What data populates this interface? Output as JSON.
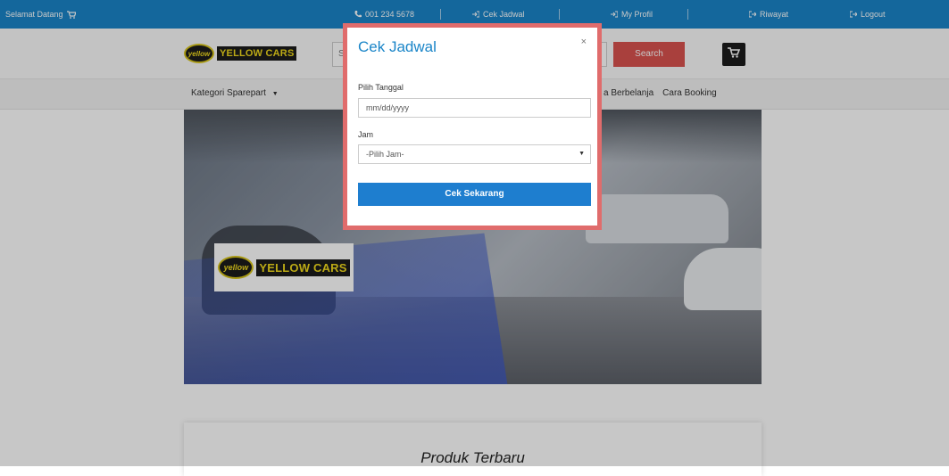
{
  "topbar": {
    "welcome": "Selamat Datang",
    "phone": "001 234 5678",
    "links": [
      "Cek Jadwal",
      "My Profil",
      "Riwayat",
      "Logout"
    ]
  },
  "header": {
    "logo_badge": "yellow",
    "logo_text": "YELLOW CARS",
    "search_placeholder": "S",
    "search_button": "Search"
  },
  "nav": {
    "kategori": "Kategori Sparepart",
    "links": [
      "a Berbelanja",
      "Cara Booking"
    ]
  },
  "banner": {
    "logo_badge": "yellow",
    "logo_text": "YELLOW CARS"
  },
  "produk": {
    "title": "Produk Terbaru"
  },
  "modal": {
    "title": "Cek Jadwal",
    "close": "×",
    "date_label": "Pilih Tanggal",
    "date_placeholder": "mm/dd/yyyy",
    "time_label": "Jam",
    "time_selected": "-Pilih Jam-",
    "submit": "Cek Sekarang"
  },
  "colors": {
    "topbar": "#1a85c8",
    "search_button": "#d9534f",
    "modal_border": "#e06c6c",
    "primary_button": "#1e7ecf"
  }
}
